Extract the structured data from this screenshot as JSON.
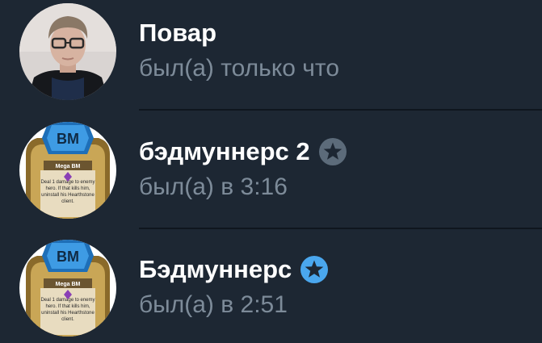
{
  "contacts": [
    {
      "name": "Повар",
      "status": "был(а) только что",
      "badge": null,
      "avatar": "person-photo"
    },
    {
      "name": "бэдмуннерс 2",
      "status": "был(а) в 3:16",
      "badge": "star-icon",
      "badge_color": "#5c6b7a",
      "avatar": "card-art",
      "card": {
        "logo": "BM",
        "title": "Mega BM",
        "text": [
          "Deal 1 damage to enemy",
          "hero. If that kills him,",
          "uninstall his Hearthstone",
          "client."
        ]
      }
    },
    {
      "name": "Бэдмуннерс",
      "status": "был(а) в 2:51",
      "badge": "star-icon",
      "badge_color": "#4aa7ee",
      "avatar": "card-art",
      "card": {
        "logo": "BM",
        "title": "Mega BM",
        "text": [
          "Deal 1 damage to enemy",
          "hero. If that kills him,",
          "uninstall his Hearthstone",
          "client."
        ]
      }
    }
  ],
  "colors": {
    "background": "#1d2733",
    "name_text": "#ffffff",
    "status_text": "#7d8b99",
    "divider": "#0f161e"
  }
}
